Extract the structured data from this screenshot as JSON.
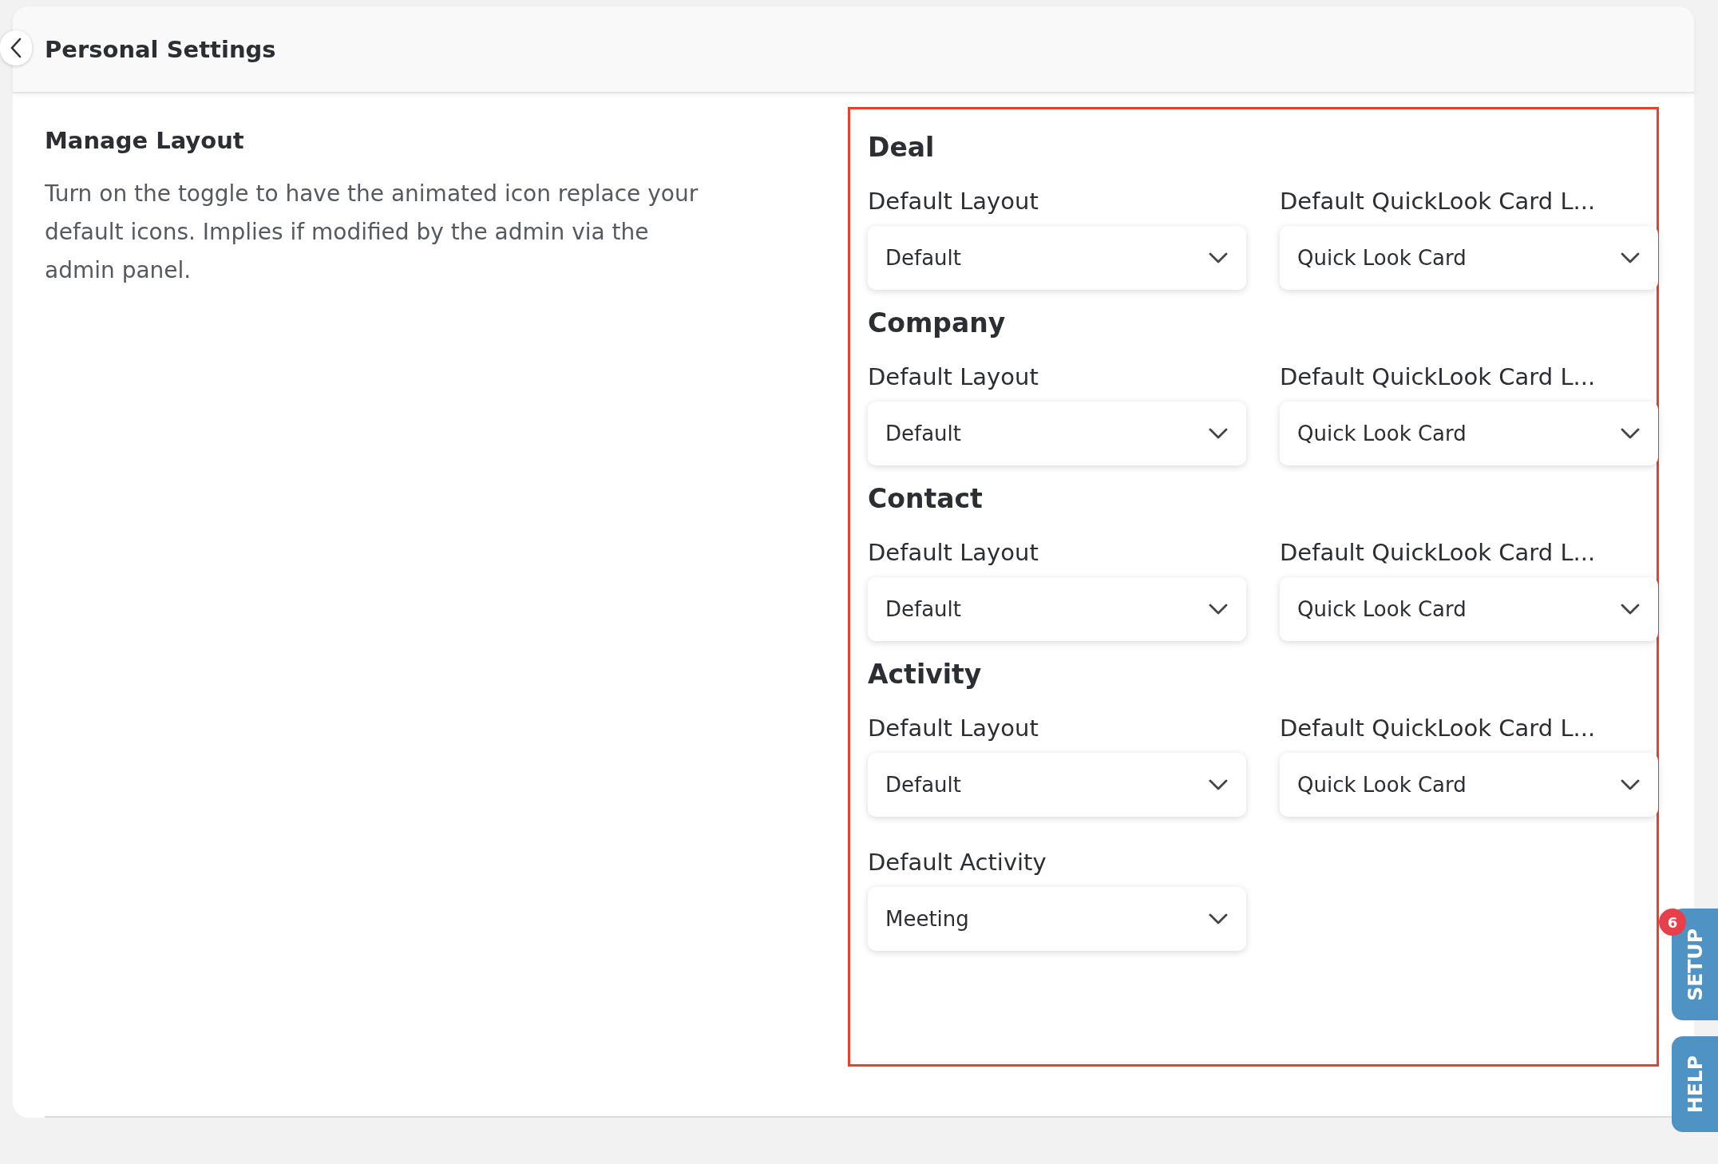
{
  "header": {
    "title": "Personal Settings"
  },
  "intro": {
    "heading": "Manage Layout",
    "description": "Turn on the toggle to have the animated icon replace your default icons. Implies if modified by the admin via the admin panel."
  },
  "sections": [
    {
      "title": "Deal",
      "fields": [
        {
          "label": "Default Layout",
          "value": "Default"
        },
        {
          "label": "Default QuickLook Card L...",
          "value": "Quick Look Card"
        }
      ]
    },
    {
      "title": "Company",
      "fields": [
        {
          "label": "Default Layout",
          "value": "Default"
        },
        {
          "label": "Default QuickLook Card L...",
          "value": "Quick Look Card"
        }
      ]
    },
    {
      "title": "Contact",
      "fields": [
        {
          "label": "Default Layout",
          "value": "Default"
        },
        {
          "label": "Default QuickLook Card L...",
          "value": "Quick Look Card"
        }
      ]
    },
    {
      "title": "Activity",
      "fields": [
        {
          "label": "Default Layout",
          "value": "Default"
        },
        {
          "label": "Default QuickLook Card L...",
          "value": "Quick Look Card"
        },
        {
          "label": "Default Activity",
          "value": "Meeting"
        }
      ]
    }
  ],
  "side_tabs": [
    {
      "label": "SETUP",
      "badge": "6"
    },
    {
      "label": "HELP"
    }
  ]
}
